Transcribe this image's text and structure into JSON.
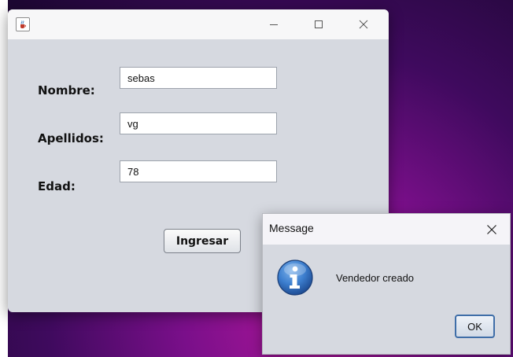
{
  "main_window": {
    "app_icon": "java-cup-icon",
    "controls": {
      "minimize_icon": "minimize-icon",
      "maximize_icon": "maximize-icon",
      "close_icon": "close-icon"
    },
    "form": {
      "nombre_label": "Nombre:",
      "nombre_value": "sebas",
      "apellidos_label": "Apellidos:",
      "apellidos_value": "vg",
      "edad_label": "Edad:",
      "edad_value": "78",
      "submit_label": "Ingresar"
    }
  },
  "dialog": {
    "title": "Message",
    "icon": "info-icon",
    "message": "Vendedor creado",
    "ok_label": "OK",
    "accent_color": "#3f6ea8"
  }
}
